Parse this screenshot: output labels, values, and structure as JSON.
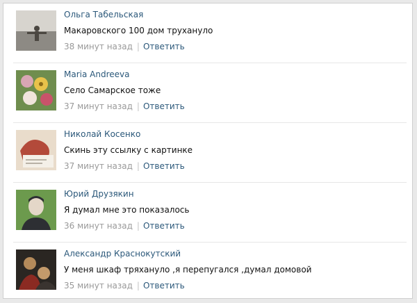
{
  "comments": [
    {
      "author": "Ольга Табельская",
      "text": "Макаровского 100 дом трухануло",
      "time": "38 минут назад",
      "separator": "|",
      "reply": "Ответить",
      "avatar_colors": [
        "#c9c6c0",
        "#8a8780",
        "#4b4741"
      ]
    },
    {
      "author": "Maria Andreeva",
      "text": "Село Самарское тоже",
      "time": "37 минут назад",
      "separator": "|",
      "reply": "Ответить",
      "avatar_colors": [
        "#6f8d4e",
        "#e8c24a",
        "#c9536a"
      ]
    },
    {
      "author": "Николай Косенко",
      "text": "Скинь эту ссылку с картинке",
      "time": "37 минут назад",
      "separator": "|",
      "reply": "Ответить",
      "avatar_colors": [
        "#e9dccb",
        "#b34a3a",
        "#f4f0e8"
      ]
    },
    {
      "author": "Юрий Друзякин",
      "text": "Я думал мне это показалось",
      "time": "36 минут назад",
      "separator": "|",
      "reply": "Ответить",
      "avatar_colors": [
        "#6c9a4d",
        "#e4d7c8",
        "#2d2f33"
      ]
    },
    {
      "author": "Александр Краснокутский",
      "text": "У меня шкаф тряхануло ,я перепугался ,думал домовой",
      "time": "35 минут назад",
      "separator": "|",
      "reply": "Ответить",
      "avatar_colors": [
        "#2a2622",
        "#b48a5a",
        "#8b2a22"
      ]
    }
  ],
  "colors": {
    "link": "#2b587a",
    "meta": "#999999",
    "text": "#111111",
    "divider": "#e6e6e6"
  }
}
